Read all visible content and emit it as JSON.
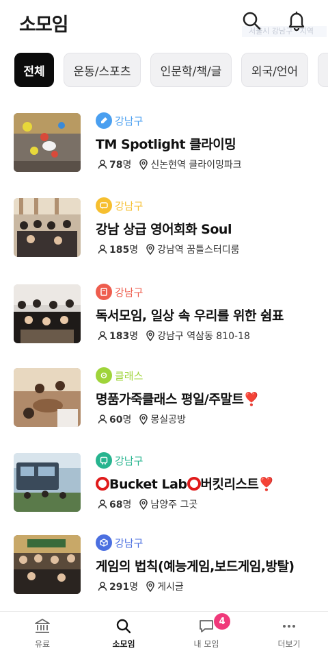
{
  "header": {
    "title": "소모임",
    "faded_text": "서울시 강남구 · 지역"
  },
  "chips": [
    {
      "label": "전체",
      "active": true
    },
    {
      "label": "운동/스포츠",
      "active": false
    },
    {
      "label": "인문학/책/글",
      "active": false
    },
    {
      "label": "외국/언어",
      "active": false
    },
    {
      "label": "",
      "active": false
    }
  ],
  "groups": [
    {
      "category": "강남구",
      "category_icon": "rocket-icon",
      "category_color": "#4a9ff0",
      "name": "TM Spotlight 클라이밍",
      "members": "78",
      "member_unit": "명",
      "place": "신논현역 클라이밍파크"
    },
    {
      "category": "강남구",
      "category_icon": "chat-icon",
      "category_color": "#f6bf2f",
      "name": "강남 상급 영어회화 Soul",
      "members": "185",
      "member_unit": "명",
      "place": "강남역 꿈틀스터디룸"
    },
    {
      "category": "강남구",
      "category_icon": "book-icon",
      "category_color": "#ee5d4e",
      "name": "독서모임, 일상 속 우리를 위한 쉼표",
      "members": "183",
      "member_unit": "명",
      "place": "강남구 역삼동 810-18"
    },
    {
      "category": "클래스",
      "category_icon": "gear-icon",
      "category_color": "#9fd43a",
      "name": "명품가죽클래스 평일/주말",
      "name_suffix": "트",
      "name_heart": "❣️",
      "members": "60",
      "member_unit": "명",
      "place": "몽실공방"
    },
    {
      "category": "강남구",
      "category_icon": "bus-icon",
      "category_color": "#27b48f",
      "name_part1": "Bucket Lab",
      "name_part2": "버킷리스트",
      "name_heart": "❣️",
      "members": "68",
      "member_unit": "명",
      "place": "남양주 그곳"
    },
    {
      "category": "강남구",
      "category_icon": "cube-icon",
      "category_color": "#4b6fe0",
      "name": "게임의 법칙(예능게임,보드게임,방탈)",
      "members": "291",
      "member_unit": "명",
      "place": "게시글"
    }
  ],
  "bottom_nav": [
    {
      "label": "유료",
      "icon": "bank-icon",
      "active": false
    },
    {
      "label": "소모임",
      "icon": "search-icon",
      "active": true
    },
    {
      "label": "내 모임",
      "icon": "chat-bubble-icon",
      "active": false,
      "badge": "4"
    },
    {
      "label": "더보기",
      "icon": "more-icon",
      "active": false
    }
  ],
  "colors": {
    "accent_badge": "#f0397a",
    "active_chip": "#0b0b0b"
  }
}
